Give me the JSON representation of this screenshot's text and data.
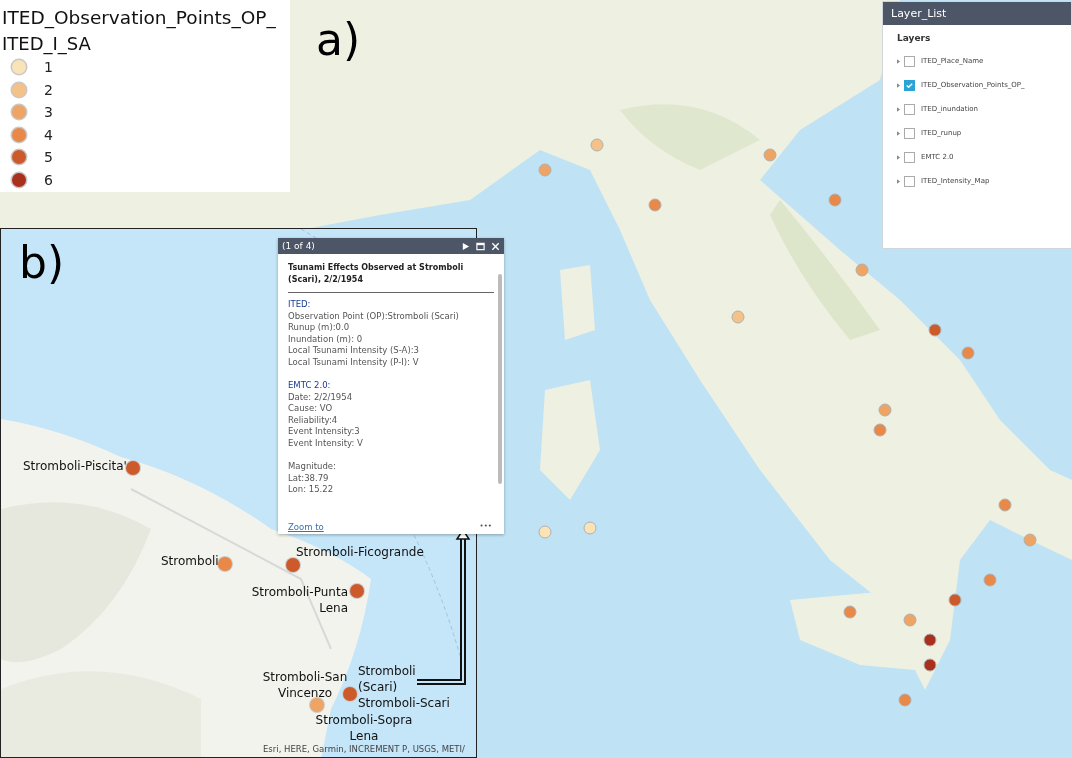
{
  "panel_labels": [
    "a)",
    "b)"
  ],
  "legend": {
    "layer": "ITED_Observation_Points_OP_",
    "field": "ITED_I_SA",
    "classes": [
      {
        "label": "1",
        "color": "#fbe3b8"
      },
      {
        "label": "2",
        "color": "#f4c188"
      },
      {
        "label": "3",
        "color": "#eea465"
      },
      {
        "label": "4",
        "color": "#e8894a"
      },
      {
        "label": "5",
        "color": "#cc5a2a"
      },
      {
        "label": "6",
        "color": "#a8301c"
      }
    ]
  },
  "layer_list": {
    "title": "Layer_List",
    "heading": "Layers",
    "layers": [
      {
        "name": "ITED_Place_Name",
        "checked": false
      },
      {
        "name": "ITED_Observation_Points_OP_",
        "checked": true
      },
      {
        "name": "ITED_inundation",
        "checked": false
      },
      {
        "name": "ITED_runup",
        "checked": false
      },
      {
        "name": "EMTC 2.0",
        "checked": false
      },
      {
        "name": "ITED_Intensity_Map",
        "checked": false
      }
    ]
  },
  "popup": {
    "counter": "(1 of 4)",
    "title": "Tsunami Effects Observed at Stromboli (Scari), 2/2/1954",
    "sections": [
      {
        "heading": "ITED:",
        "lines": [
          "Observation Point (OP):Stromboli (Scari)",
          "Runup (m):0.0",
          "Inundation (m): 0",
          "Local Tsunami Intensity (S-A):3",
          "Local Tsunami Intensity (P-I): V"
        ]
      },
      {
        "heading": "EMTC 2.0:",
        "lines": [
          "Date: 2/2/1954",
          "Cause: VO",
          "Reliability:4",
          "Event Intensity:3",
          "Event Intensity: V"
        ]
      },
      {
        "lines": [
          "Magnitude:",
          "Lat:38.79",
          "Lon: 15.22"
        ]
      }
    ],
    "link": "Zoom to",
    "more": "•••"
  },
  "feature_labels": [
    {
      "lines": [
        "Stromboli-Piscita'"
      ],
      "color": "#cc5a2a"
    },
    {
      "lines": [
        "Stromboli"
      ],
      "color": "#e8894a"
    },
    {
      "lines": [
        "Stromboli-Ficogrande"
      ],
      "color": "#cc5a2a"
    },
    {
      "lines": [
        "Stromboli-Punta",
        "Lena"
      ],
      "color": "#cc5a2a"
    },
    {
      "lines": [
        "Stromboli-San",
        "Vincenzo"
      ],
      "color": "#eea465"
    },
    {
      "lines": [
        "Stromboli",
        "(Scari)",
        "Stromboli-Scari"
      ],
      "color": "#cc5a2a"
    },
    {
      "lines": [
        "Stromboli-Sopra",
        "Lena"
      ]
    }
  ],
  "attribution": "Esri, HERE, Garmin, INCREMENT P, USGS, METI/"
}
